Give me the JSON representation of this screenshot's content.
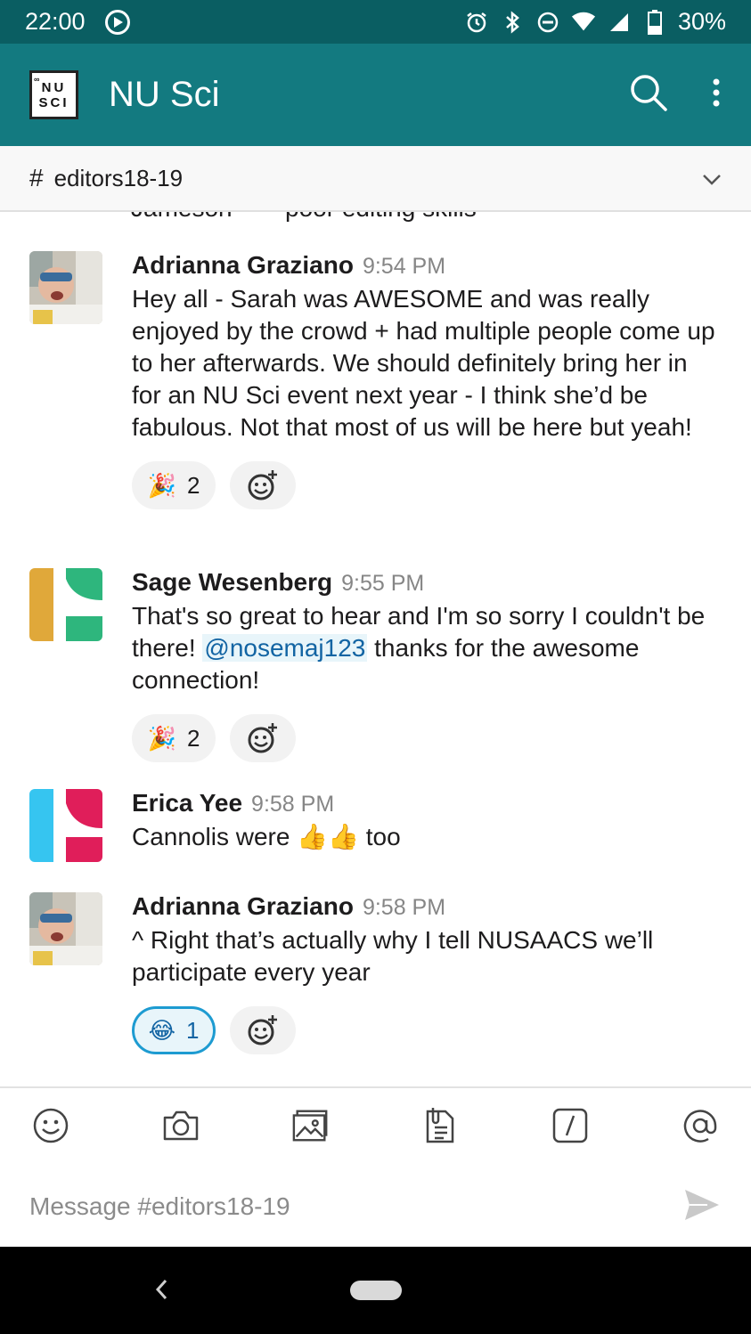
{
  "status_bar": {
    "time": "22:00",
    "battery": "30%"
  },
  "app_bar": {
    "logo_top": "NU",
    "logo_bottom": "SCI",
    "logo_mark": "∞",
    "title": "NU Sci"
  },
  "channel": {
    "hash": "#",
    "name": "editors18-19"
  },
  "cut_message": {
    "name_fragment": "Jameson",
    "text_fragment": "poor editing skills"
  },
  "messages": [
    {
      "author": "Adrianna Graziano",
      "time": "9:54 PM",
      "text": "Hey all - Sarah was AWESOME and was really enjoyed by the crowd + had multiple people come up to her afterwards. We should definitely bring her in for an NU Sci event next year  - I think she’d be fabulous. Not that most of us will be here but yeah!",
      "reaction": {
        "emoji": "🎉",
        "count": "2"
      }
    },
    {
      "author": "Sage Wesenberg",
      "time": "9:55 PM",
      "text_before": "That's so great to hear and I'm so sorry I couldn't be there! ",
      "mention": "@nosemaj123",
      "text_after": " thanks for the awesome connection!",
      "reaction": {
        "emoji": "🎉",
        "count": "2"
      }
    },
    {
      "author": "Erica Yee",
      "time": "9:58 PM",
      "text_before": "Cannolis were ",
      "emoji": "👍👍",
      "text_after": " too"
    },
    {
      "author": "Adrianna Graziano",
      "time": "9:58 PM",
      "text": "^ Right that’s actually why I tell NUSAACS we’ll participate every year",
      "reaction": {
        "emoji": "😂",
        "count": "1"
      }
    }
  ],
  "composer": {
    "placeholder": "Message #editors18-19"
  },
  "colors": {
    "status_bar": "#0a5e62",
    "app_bar": "#137a80",
    "link": "#1264a3"
  }
}
